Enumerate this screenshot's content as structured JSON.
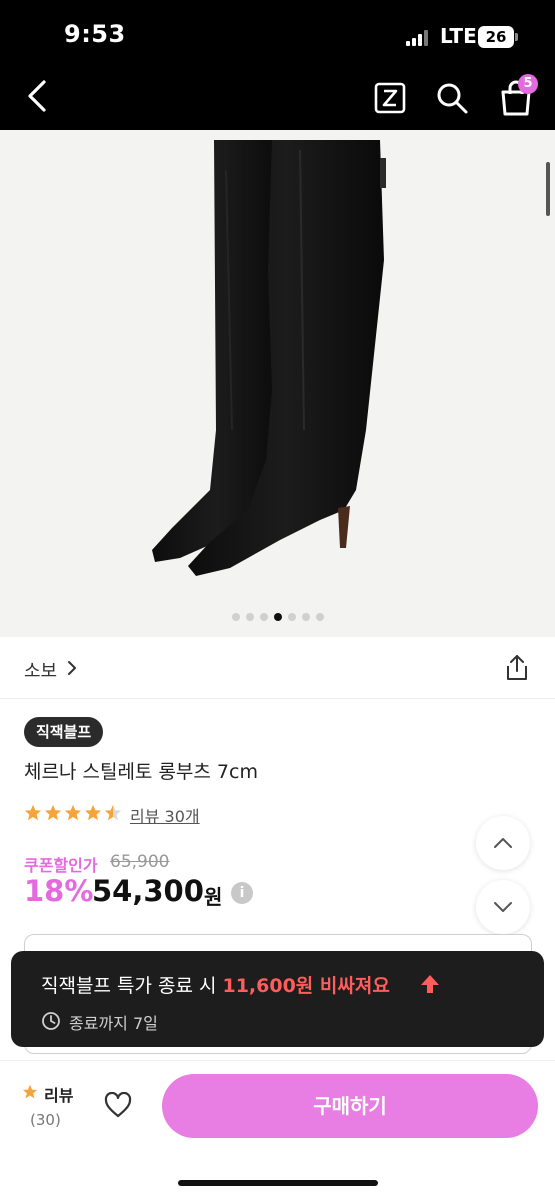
{
  "status_bar": {
    "time": "9:53",
    "network": "LTE",
    "battery": "26"
  },
  "header": {
    "cart_count": "5",
    "icons": [
      "back-icon",
      "z-icon",
      "search-icon",
      "bag-icon"
    ]
  },
  "gallery": {
    "slide_count": 7,
    "active_slide": 4
  },
  "brand": {
    "name": "소보"
  },
  "product": {
    "badge": "직잭블프",
    "title": "체르나 스틸레토 롱부츠 7cm",
    "rating": 4.5,
    "review_link": "리뷰 30개"
  },
  "pricing": {
    "coupon_label": "쿠폰할인가",
    "original_price": "65,900",
    "discount": "18%",
    "price": "54,300",
    "currency": "원",
    "info_icon": "i"
  },
  "toast": {
    "text_before": "직잭블프 특가 종료 시 ",
    "highlight": "11,600원 비싸져요",
    "subtext": "종료까지 7일"
  },
  "bottom_bar": {
    "review_label": "리뷰",
    "review_count": "(30)",
    "buy_label": "구매하기"
  },
  "colors": {
    "accent": "#e56ae0",
    "buy_button": "#e87ee3",
    "toast_highlight": "#ff5c5c"
  }
}
